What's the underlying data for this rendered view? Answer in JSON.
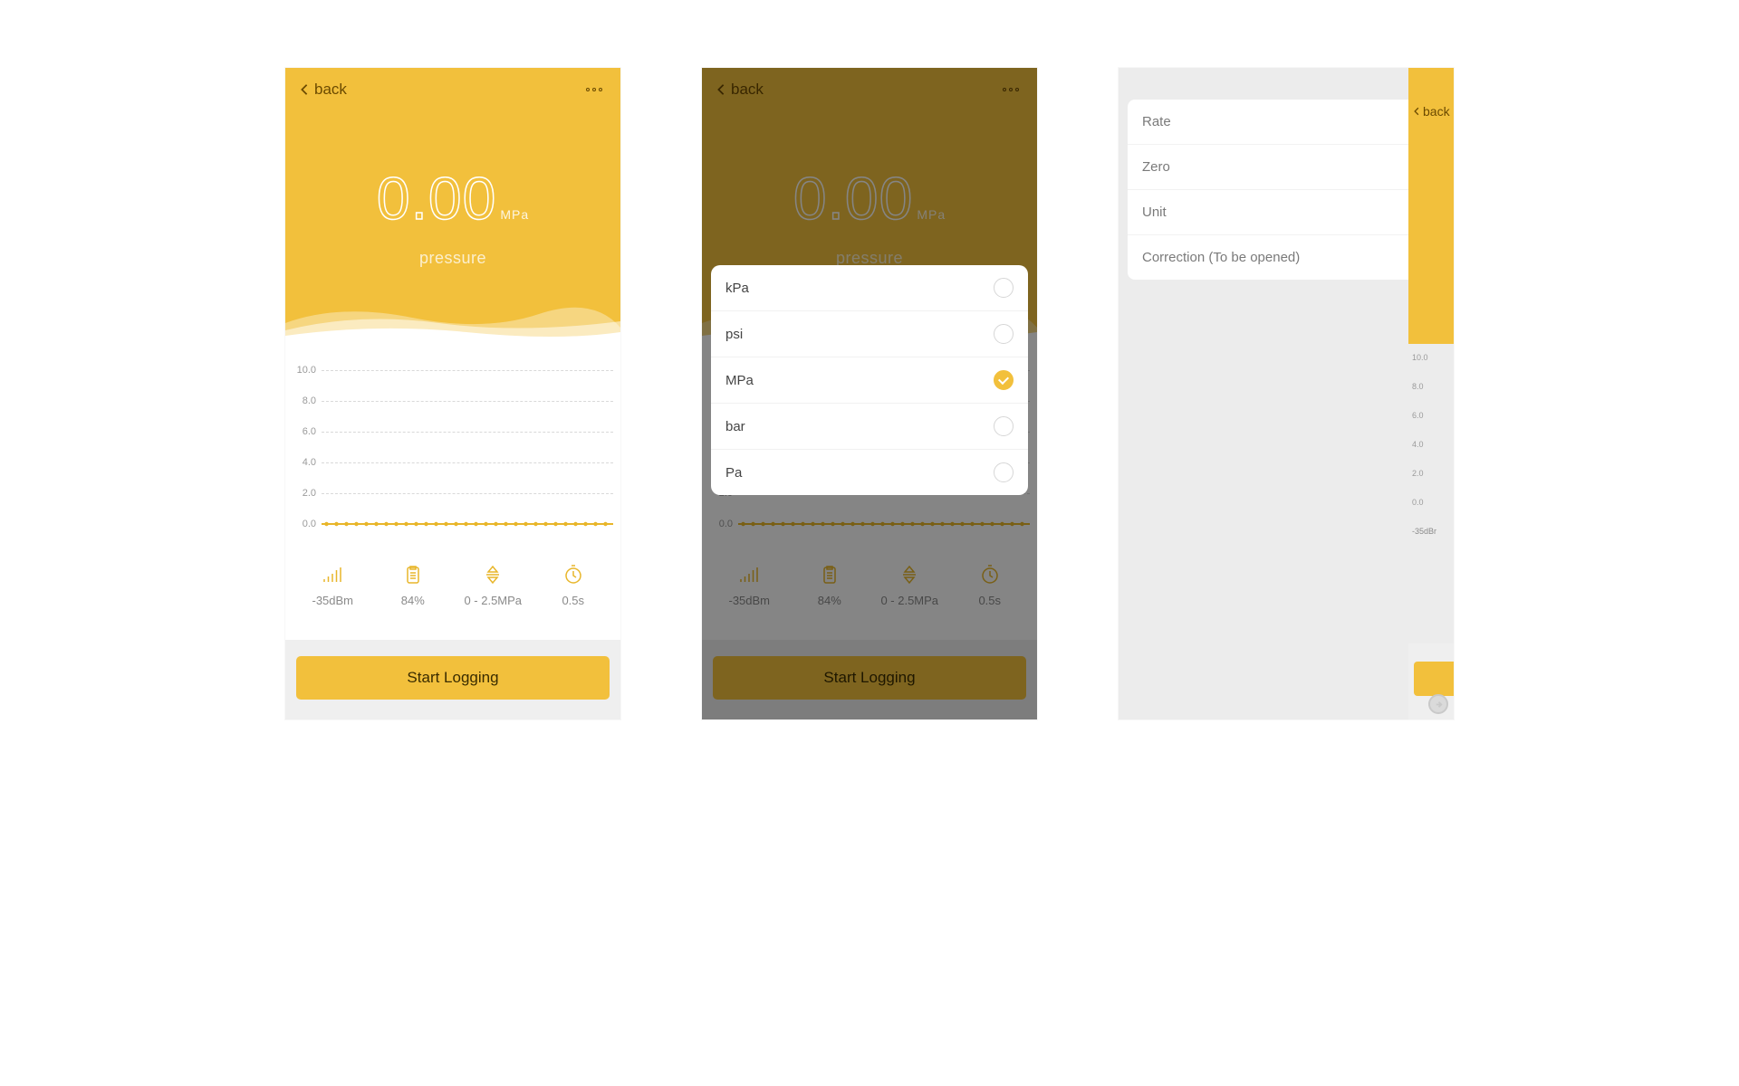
{
  "nav": {
    "back_label": "back"
  },
  "reading": {
    "value": "0.00",
    "unit": "MPa",
    "label": "pressure"
  },
  "chart_data": {
    "type": "line",
    "title": "",
    "xlabel": "",
    "ylabel": "",
    "ylim": [
      0,
      10
    ],
    "y_ticks": [
      "10.0",
      "8.0",
      "6.0",
      "4.0",
      "2.0",
      "0.0"
    ],
    "series": [
      {
        "name": "pressure",
        "values": [
          0,
          0,
          0,
          0,
          0,
          0,
          0,
          0,
          0,
          0,
          0,
          0,
          0,
          0,
          0,
          0,
          0,
          0,
          0,
          0,
          0,
          0,
          0,
          0,
          0,
          0,
          0,
          0,
          0,
          0
        ]
      }
    ]
  },
  "stats": {
    "signal": "-35dBm",
    "battery": "84%",
    "range": "0 - 2.5MPa",
    "interval": "0.5s"
  },
  "button": {
    "start_label": "Start Logging"
  },
  "unit_picker": {
    "options": [
      {
        "label": "kPa",
        "selected": false
      },
      {
        "label": "psi",
        "selected": false
      },
      {
        "label": "MPa",
        "selected": true
      },
      {
        "label": "bar",
        "selected": false
      },
      {
        "label": "Pa",
        "selected": false
      }
    ]
  },
  "settings": {
    "items": [
      {
        "label": "Rate"
      },
      {
        "label": "Zero"
      },
      {
        "label": "Unit"
      },
      {
        "label": "Correction (To be opened)"
      }
    ]
  },
  "peek": {
    "back_label": "back",
    "stat_signal": "-35dBr"
  },
  "colors": {
    "accent": "#f2c03c"
  }
}
